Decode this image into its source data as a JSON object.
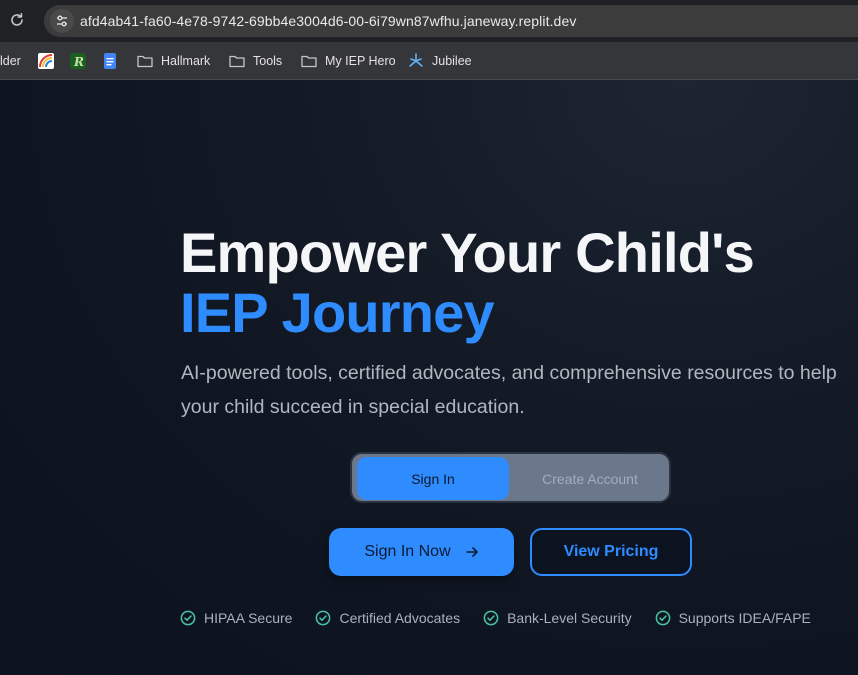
{
  "browser": {
    "url": "afd4ab41-fa60-4e78-9742-69bb4e3004d6-00-6i79wn87wfhu.janeway.replit.dev",
    "bookmarks": [
      {
        "label": "lder",
        "icon": "folder-icon"
      },
      {
        "label": "",
        "icon": "rainbow-app-icon"
      },
      {
        "label": "",
        "icon": "r-app-icon"
      },
      {
        "label": "",
        "icon": "docs-icon"
      },
      {
        "label": "Hallmark",
        "icon": "folder-icon"
      },
      {
        "label": "Tools",
        "icon": "folder-icon"
      },
      {
        "label": "My IEP Hero",
        "icon": "folder-icon"
      },
      {
        "label": "Jubilee",
        "icon": "jubilee-icon"
      }
    ]
  },
  "hero": {
    "title_line1": "Empower Your Child's",
    "title_line2": "IEP Journey",
    "subtitle": "AI-powered tools, certified advocates, and comprehensive resources to help your child succeed in special education."
  },
  "auth_toggle": {
    "sign_in": "Sign In",
    "create_account": "Create Account",
    "selected": "Sign In"
  },
  "cta": {
    "primary": "Sign In Now",
    "secondary": "View Pricing"
  },
  "badges": [
    "HIPAA Secure",
    "Certified Advocates",
    "Bank-Level Security",
    "Supports IDEA/FAPE"
  ],
  "colors": {
    "accent": "#2f8cff",
    "background": "#0d1320",
    "badge_check": "#4cc3a3"
  }
}
